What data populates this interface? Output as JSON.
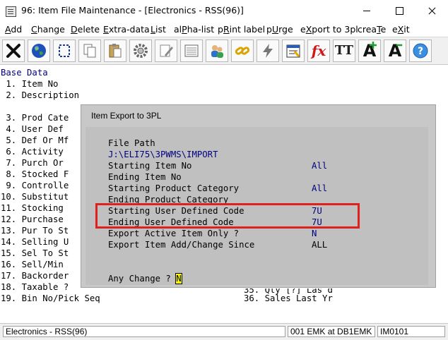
{
  "window": {
    "title": "96: Item File Maintenance - [Electronics - RSS(96)]"
  },
  "menu": [
    {
      "label": "Add",
      "accel": "A"
    },
    {
      "label": "Change",
      "accel": "C"
    },
    {
      "label": "Delete",
      "accel": "D"
    },
    {
      "label": "Extra-data",
      "accel": "E"
    },
    {
      "label": "List",
      "accel": "L"
    },
    {
      "label": "alPha-list",
      "accel": "P"
    },
    {
      "label": "pRint label",
      "accel": "R"
    },
    {
      "label": "pUrge",
      "accel": "U"
    },
    {
      "label": "eXport to 3pl",
      "accel": "X"
    },
    {
      "label": "creaTe",
      "accel": "T"
    },
    {
      "label": "eXit",
      "accel": "X"
    }
  ],
  "toolbar": {
    "buttons": [
      "close-icon",
      "globe-icon",
      "select-icon",
      "copy-icon",
      "paste-icon",
      "settings-gear-icon",
      "edit-icon",
      "list-icon",
      "users-icon",
      "link-icon",
      "lightning-icon",
      "calendar-icon",
      "function-icon",
      "text-style-icon",
      "font-increase-icon",
      "font-decrease-icon",
      "help-icon"
    ],
    "fx_label": "fx",
    "tt_label": "TT",
    "a_label": "A"
  },
  "terminal": {
    "header": "Base Data",
    "lines": [
      " 1. Item No",
      " 2. Description",
      "",
      " 3. Prod Cate",
      " 4. User Def ",
      " 5. Def Or Mf",
      " 6. Activity ",
      " 7. Purch Or ",
      " 8. Stocked F",
      " 9. Controlle",
      "10. Substitut",
      "11. Stocking ",
      "12. Purchase ",
      "13. Pur To St",
      "14. Selling U",
      "15. Sel To St",
      "16. Sell/Min ",
      "17. Backorder",
      "18. Taxable ?",
      "19. Bin No/Pick Seq"
    ],
    "right_partial": "35. Qty [?] Las d",
    "right_line": "36. Sales Last Yr"
  },
  "dialog": {
    "title": "Item Export to 3PL",
    "fields": [
      {
        "label": "File Path",
        "value": ""
      },
      {
        "label": "J:\\ELI75\\3PWMS\\IMPORT",
        "value": "",
        "label_blue": true
      },
      {
        "label": "Starting Item No",
        "value": "All"
      },
      {
        "label": "Ending Item No",
        "value": ""
      },
      {
        "label": "Starting Product Category",
        "value": "All"
      },
      {
        "label": "Ending Product Category",
        "value": ""
      },
      {
        "label": "Starting User Defined Code",
        "value": "7U"
      },
      {
        "label": "Ending User Defined Code",
        "value": "7U"
      },
      {
        "label": "Export Active Item Only ?",
        "value": "N"
      },
      {
        "label": "Export Item Add/Change Since",
        "value": "ALL",
        "value_black": true
      }
    ],
    "prompt": "Any Change ?",
    "prompt_value": "N"
  },
  "status": {
    "left": "Electronics - RSS(96)",
    "middle": "001 EMK at DB1EMK",
    "right": "IM0101"
  }
}
